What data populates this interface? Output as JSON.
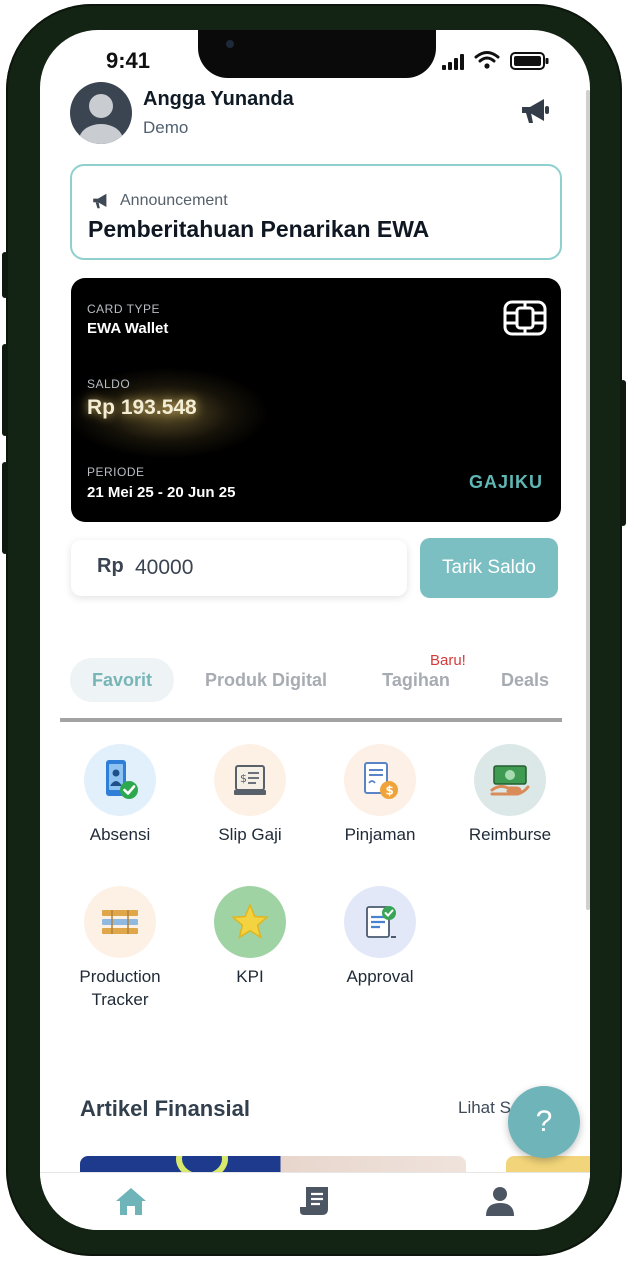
{
  "status_bar": {
    "time": "9:41"
  },
  "user": {
    "name": "Angga Yunanda",
    "subtitle": "Demo"
  },
  "announcement": {
    "label": "Announcement",
    "title": "Pemberitahuan Penarikan EWA"
  },
  "card": {
    "type_label": "CARD TYPE",
    "type_value": "EWA Wallet",
    "saldo_label": "SALDO",
    "saldo_value": "Rp 193.548",
    "periode_label": "PERIODE",
    "periode_value": "21 Mei 25 - 20 Jun 25",
    "brand": "GAJIKU"
  },
  "withdraw": {
    "currency": "Rp",
    "amount": "40000",
    "button_label": "Tarik Saldo"
  },
  "tabs": [
    {
      "label": "Favorit",
      "active": true
    },
    {
      "label": "Produk Digital"
    },
    {
      "label": "Tagihan",
      "badge": "Baru!"
    },
    {
      "label": "Deals"
    }
  ],
  "menu": [
    {
      "label": "Absensi",
      "icon": "attendance-icon"
    },
    {
      "label": "Slip Gaji",
      "icon": "payslip-icon"
    },
    {
      "label": "Pinjaman",
      "icon": "loan-icon"
    },
    {
      "label": "Reimburse",
      "icon": "reimburse-icon"
    },
    {
      "label": "Production Tracker",
      "icon": "production-tracker-icon"
    },
    {
      "label": "KPI",
      "icon": "star-icon"
    },
    {
      "label": "Approval",
      "icon": "approval-icon"
    }
  ],
  "articles": {
    "title": "Artikel Finansial",
    "link": "Lihat S"
  },
  "help": {
    "label": "?"
  },
  "bottom_nav": [
    {
      "icon": "home-icon",
      "active": true
    },
    {
      "icon": "receipt-icon"
    },
    {
      "icon": "profile-icon"
    }
  ],
  "colors": {
    "accent": "#7bbfc2",
    "announcement_border": "#8fd0cf",
    "badge": "#d53b3b",
    "card_bg": "#000000"
  }
}
